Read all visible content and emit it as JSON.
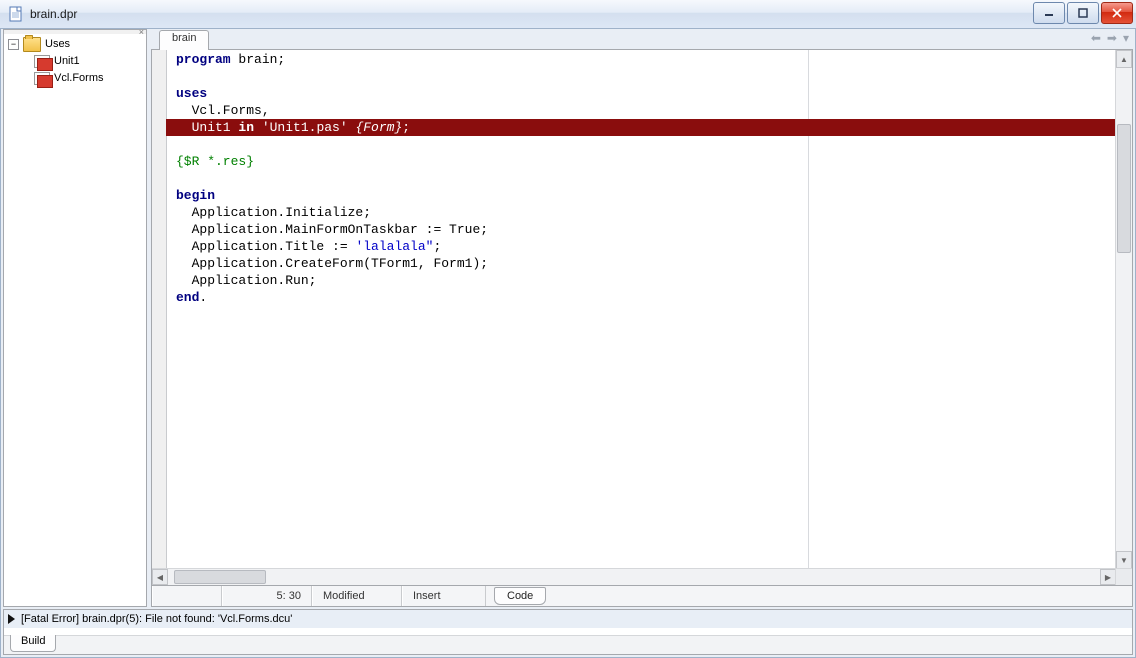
{
  "title_bar": {
    "title": "brain.dpr"
  },
  "tree": {
    "root_label": "Uses",
    "items": [
      "Unit1",
      "Vcl.Forms"
    ]
  },
  "editor": {
    "tab_label": "brain",
    "cursor_pos": "5: 30",
    "modified_label": "Modified",
    "insert_label": "Insert",
    "view_tab_label": "Code"
  },
  "code": {
    "l01_kw": "program",
    "l01_rest": " brain;",
    "l03_kw": "uses",
    "l04": "  Vcl.Forms,",
    "l05_pre": "  Unit1 ",
    "l05_in": "in",
    "l05_str": " 'Unit1.pas' ",
    "l05_cm": "{Form}",
    "l05_end": ";",
    "l07_dir": "{$R *.res}",
    "l09_kw": "begin",
    "l10": "  Application.Initialize;",
    "l11": "  Application.MainFormOnTaskbar := True;",
    "l12_pre": "  Application.Title := ",
    "l12_str": "'lalalala\"",
    "l12_end": ";",
    "l13": "  Application.CreateForm(TForm1, Form1);",
    "l14": "  Application.Run;",
    "l15_kw": "end",
    "l15_end": "."
  },
  "messages": {
    "error_text": "[Fatal Error] brain.dpr(5): File not found: 'Vcl.Forms.dcu'",
    "tab_label": "Build"
  }
}
